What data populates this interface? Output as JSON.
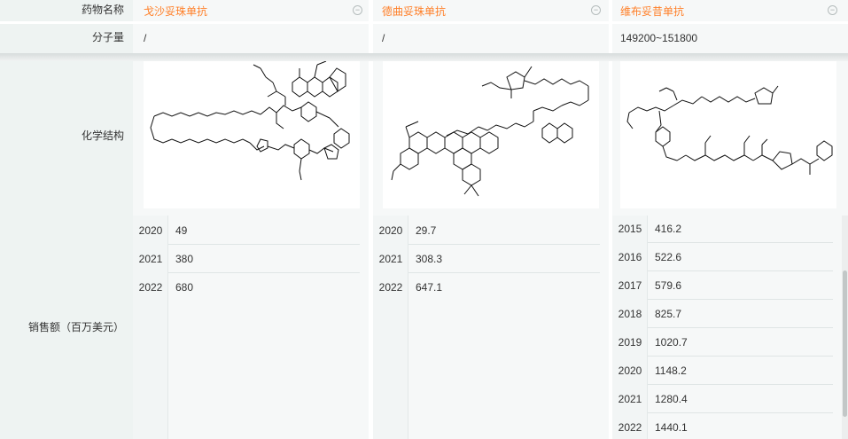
{
  "labels": {
    "drug_name": "药物名称",
    "molecular_weight": "分子量",
    "chemical_structure": "化学结构",
    "sales": "销售额（百万美元）"
  },
  "drugs": [
    {
      "name": "戈沙妥珠单抗",
      "molecular_weight": "/",
      "sales": [
        {
          "year": "2020",
          "value": "49"
        },
        {
          "year": "2021",
          "value": "380"
        },
        {
          "year": "2022",
          "value": "680"
        }
      ]
    },
    {
      "name": "德曲妥珠单抗",
      "molecular_weight": "/",
      "sales": [
        {
          "year": "2020",
          "value": "29.7"
        },
        {
          "year": "2021",
          "value": "308.3"
        },
        {
          "year": "2022",
          "value": "647.1"
        }
      ]
    },
    {
      "name": "维布妥昔单抗",
      "molecular_weight": "149200~151800",
      "sales": [
        {
          "year": "2015",
          "value": "416.2"
        },
        {
          "year": "2016",
          "value": "522.6"
        },
        {
          "year": "2017",
          "value": "579.6"
        },
        {
          "year": "2018",
          "value": "825.7"
        },
        {
          "year": "2019",
          "value": "1020.7"
        },
        {
          "year": "2020",
          "value": "1148.2"
        },
        {
          "year": "2021",
          "value": "1280.4"
        },
        {
          "year": "2022",
          "value": "1440.1"
        }
      ]
    }
  ],
  "icons": {
    "collapse": "collapse-circle-icon",
    "structure": "chemical-structure-diagram"
  },
  "colors": {
    "drug_name": "#ff7f28",
    "label_background": "#eef3f2",
    "cell_background": "#f6f8f8"
  }
}
